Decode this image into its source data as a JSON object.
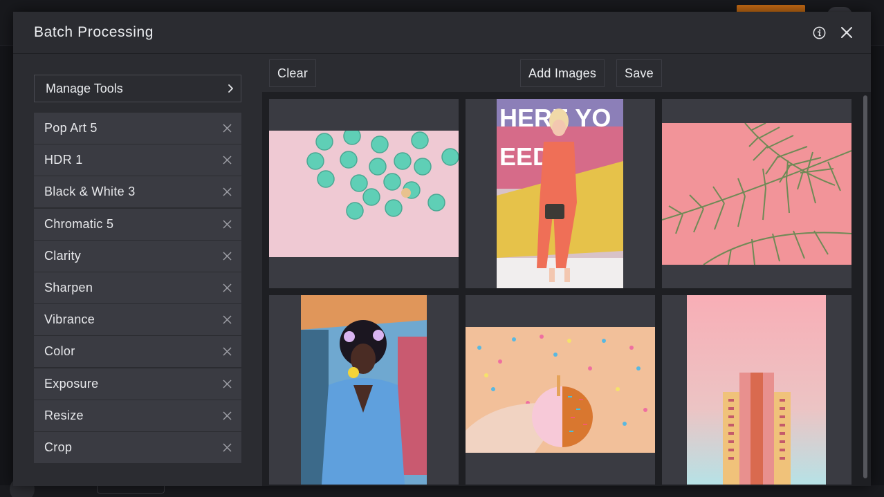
{
  "modal": {
    "title": "Batch Processing",
    "info_icon": "info-circle-icon",
    "close_icon": "close-icon"
  },
  "sidebar": {
    "manage_tools_label": "Manage Tools",
    "tools": [
      {
        "label": "Pop Art 5"
      },
      {
        "label": "HDR 1"
      },
      {
        "label": "Black & White 3"
      },
      {
        "label": "Chromatic 5"
      },
      {
        "label": "Clarity"
      },
      {
        "label": "Sharpen"
      },
      {
        "label": "Vibrance"
      },
      {
        "label": "Color"
      },
      {
        "label": "Exposure"
      },
      {
        "label": "Resize"
      },
      {
        "label": "Crop"
      }
    ]
  },
  "toolbar": {
    "clear_label": "Clear",
    "add_images_label": "Add Images",
    "save_label": "Save"
  },
  "images": [
    {
      "subject": "mint-cupcakes-on-pink"
    },
    {
      "subject": "woman-in-coral-jumpsuit"
    },
    {
      "subject": "palm-leaves-on-pink"
    },
    {
      "subject": "woman-in-denim-jacket"
    },
    {
      "subject": "sprinkle-donut-in-hand"
    },
    {
      "subject": "pink-tower-building"
    }
  ],
  "colors": {
    "modal_bg": "#2b2c31",
    "list_item_bg": "#3a3b42",
    "accent_orange": "#c96d14"
  }
}
